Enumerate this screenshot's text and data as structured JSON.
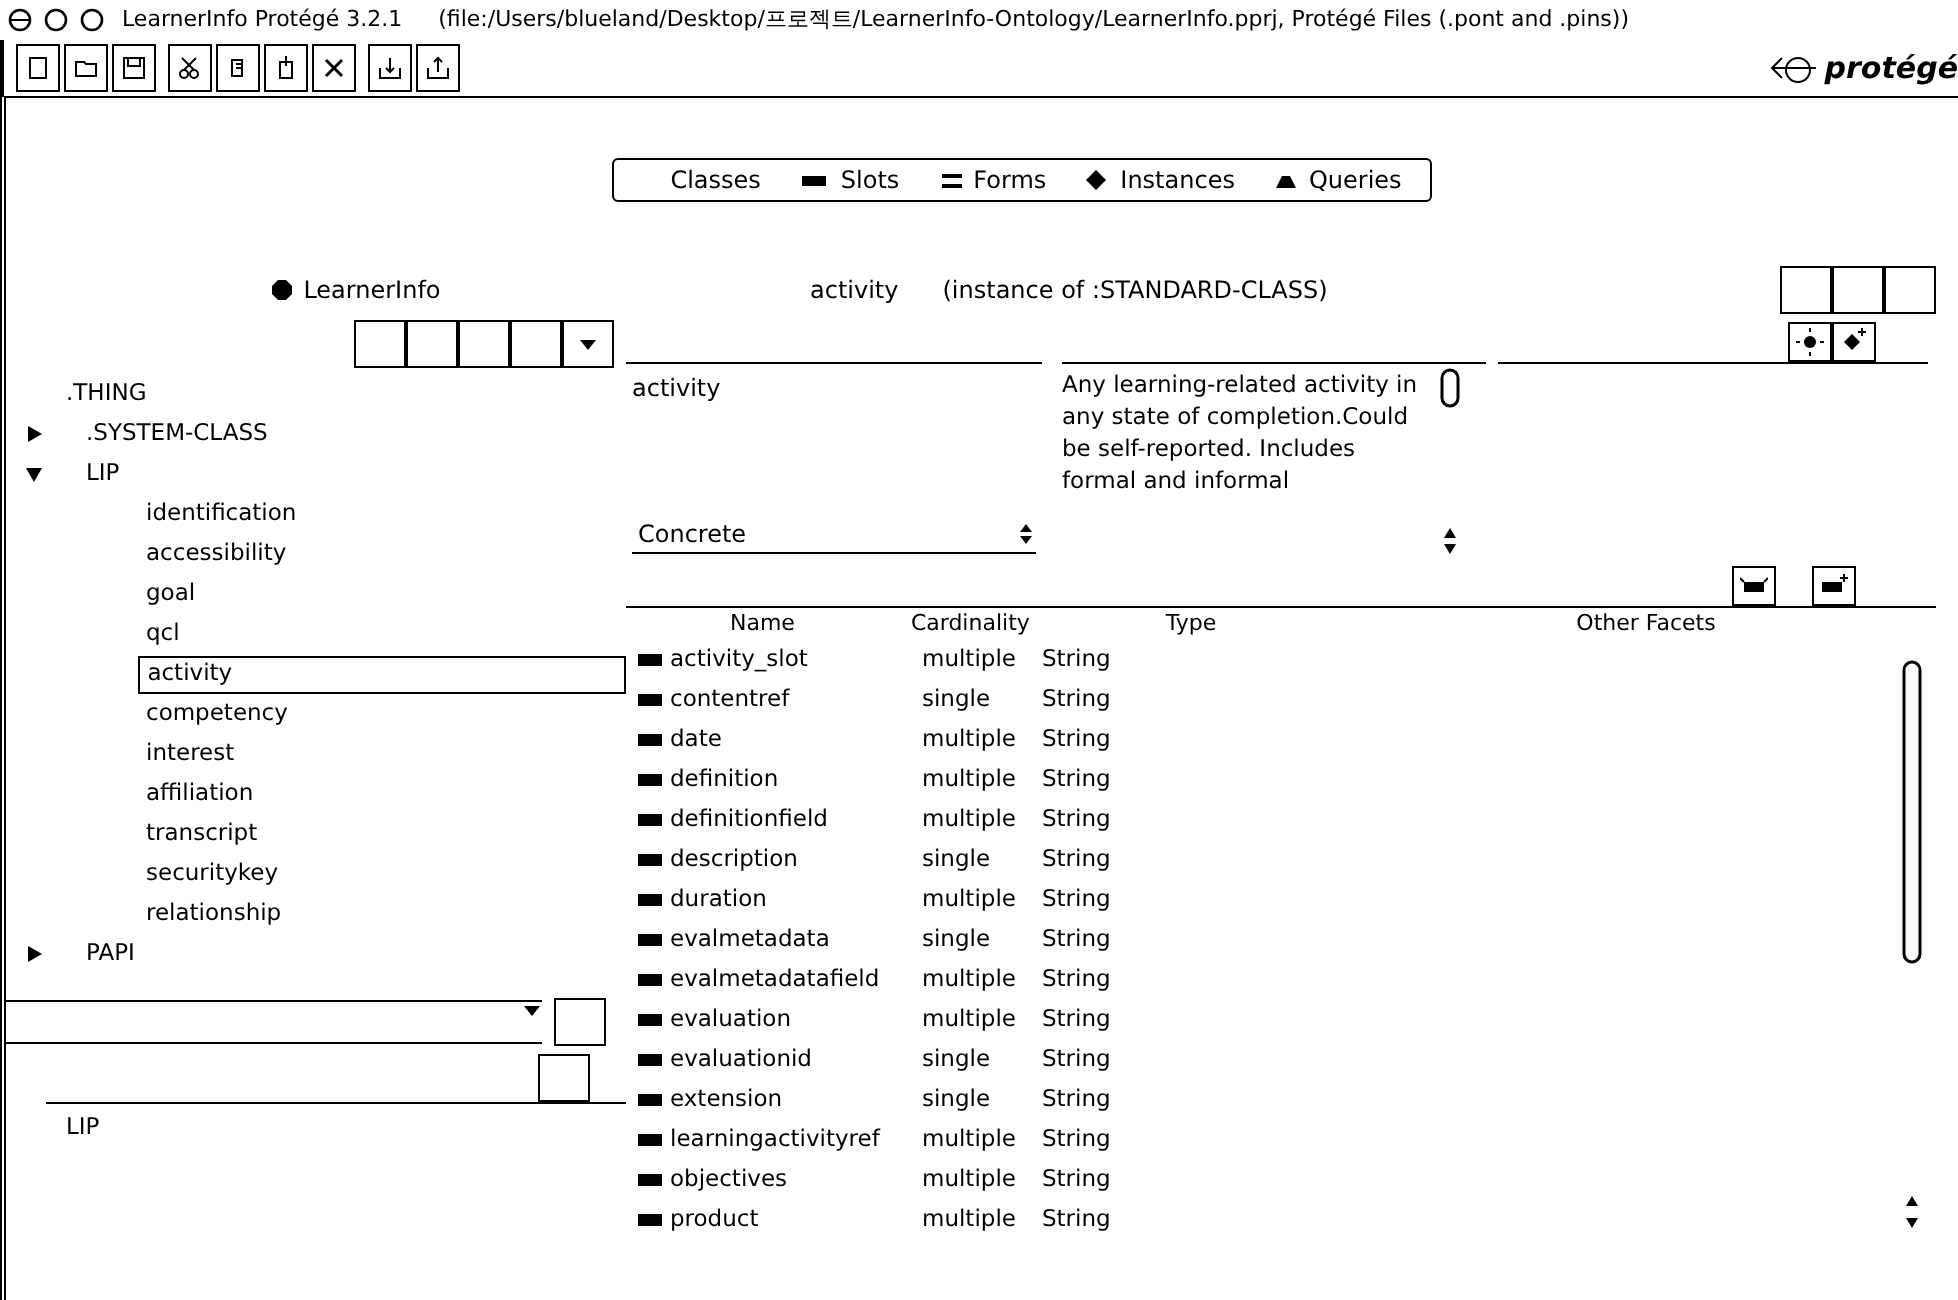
{
  "window": {
    "title": "LearnerInfo  Protégé 3.2.1",
    "file": "(file:/Users/blueland/Desktop/프로젝트/LearnerInfo-Ontology/LearnerInfo.pprj, Protégé Files (.pont and .pins))"
  },
  "logo": {
    "text": "protégé"
  },
  "tabs": [
    {
      "label": "Classes"
    },
    {
      "label": "Slots"
    },
    {
      "label": "Forms"
    },
    {
      "label": "Instances"
    },
    {
      "label": "Queries"
    }
  ],
  "class_browser": {
    "project": "LearnerInfo",
    "tree": [
      {
        "label": ".THING",
        "children": [
          {
            "label": ".SYSTEM-CLASS",
            "expanded": false,
            "selected": false
          },
          {
            "label": "LIP",
            "expanded": true,
            "selected": false,
            "children": [
              {
                "label": "identification",
                "selected": false
              },
              {
                "label": "accessibility",
                "selected": false
              },
              {
                "label": "goal",
                "selected": false
              },
              {
                "label": "qcl",
                "selected": false
              },
              {
                "label": "activity",
                "selected": true
              },
              {
                "label": "competency",
                "selected": false
              },
              {
                "label": "interest",
                "selected": false
              },
              {
                "label": "affiliation",
                "selected": false
              },
              {
                "label": "transcript",
                "selected": false
              },
              {
                "label": "securitykey",
                "selected": false
              },
              {
                "label": "relationship",
                "selected": false
              }
            ]
          },
          {
            "label": "PAPI",
            "expanded": false,
            "selected": false
          }
        ]
      }
    ],
    "superclasses": [
      "LIP"
    ]
  },
  "class_editor": {
    "name": "activity",
    "instance_of": "(instance of :STANDARD-CLASS)",
    "name_field": "activity",
    "role": "Concrete",
    "documentation": "Any learning-related activity in any state of completion.Could be self-reported. Includes formal and informal",
    "columns": [
      "Name",
      "Cardinality",
      "Type",
      "Other Facets"
    ],
    "rows": [
      {
        "name": "activity_slot",
        "cardinality": "multiple",
        "type": "String"
      },
      {
        "name": "contentref",
        "cardinality": "single",
        "type": "String"
      },
      {
        "name": "date",
        "cardinality": "multiple",
        "type": "String"
      },
      {
        "name": "definition",
        "cardinality": "multiple",
        "type": "String"
      },
      {
        "name": "definitionfield",
        "cardinality": "multiple",
        "type": "String"
      },
      {
        "name": "description",
        "cardinality": "single",
        "type": "String"
      },
      {
        "name": "duration",
        "cardinality": "multiple",
        "type": "String"
      },
      {
        "name": "evalmetadata",
        "cardinality": "single",
        "type": "String"
      },
      {
        "name": "evalmetadatafield",
        "cardinality": "multiple",
        "type": "String"
      },
      {
        "name": "evaluation",
        "cardinality": "multiple",
        "type": "String"
      },
      {
        "name": "evaluationid",
        "cardinality": "single",
        "type": "String"
      },
      {
        "name": "extension",
        "cardinality": "single",
        "type": "String"
      },
      {
        "name": "learningactivityref",
        "cardinality": "multiple",
        "type": "String"
      },
      {
        "name": "objectives",
        "cardinality": "multiple",
        "type": "String"
      },
      {
        "name": "product",
        "cardinality": "multiple",
        "type": "String"
      }
    ]
  }
}
